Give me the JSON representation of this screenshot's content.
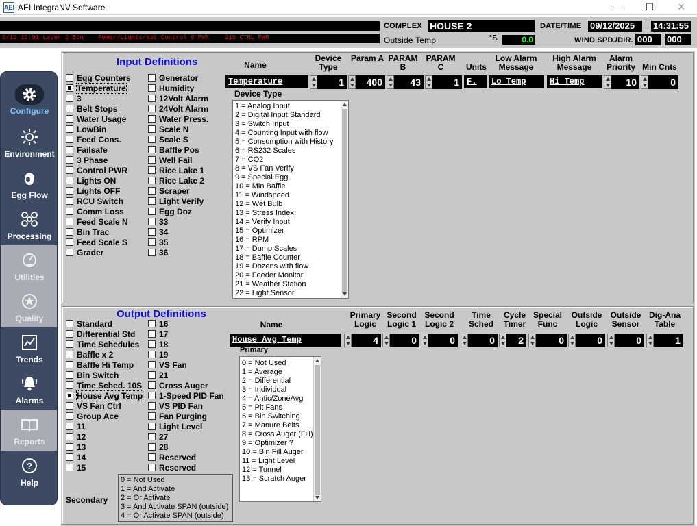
{
  "window": {
    "title": "AEI IntegraNV Software",
    "logo_text": "AEI",
    "min": "—",
    "max": "☐",
    "close": "✕"
  },
  "header": {
    "ticker": [
      "9/12 13:51 Layer 2 Btn",
      "Power/Lights/Nst Control 8 PWR",
      "215 CTRL PWR"
    ],
    "complex_label": "COMPLEX",
    "complex_value": "HOUSE 2",
    "outside_temp_label": "Outside Temp",
    "deg_f": "°F.",
    "outside_temp_value": "0.0",
    "datetime_label": "DATE/TIME",
    "date": "09/12/2025",
    "time": "14:31:55",
    "wind_label": "WIND SPD./DIR.",
    "wind_speed": "000",
    "wind_dir": "000"
  },
  "sidebar": [
    {
      "label": "Configure",
      "icon": "gear-icon",
      "state": "active"
    },
    {
      "label": "Environment",
      "icon": "sun-icon",
      "state": "normal"
    },
    {
      "label": "Egg Flow",
      "icon": "egg-icon",
      "state": "normal"
    },
    {
      "label": "Processing",
      "icon": "processing-icon",
      "state": "normal"
    },
    {
      "label": "Utilities",
      "icon": "gauge-icon",
      "state": "disabled"
    },
    {
      "label": "Quality",
      "icon": "star-icon",
      "state": "disabled"
    },
    {
      "label": "Trends",
      "icon": "chart-icon",
      "state": "normal"
    },
    {
      "label": "Alarms",
      "icon": "bell-icon",
      "state": "normal"
    },
    {
      "label": "Reports",
      "icon": "book-icon",
      "state": "disabled"
    },
    {
      "label": "Help",
      "icon": "help-icon",
      "state": "normal"
    }
  ],
  "input": {
    "title": "Input Definitions",
    "col1": [
      {
        "label": "Egg Counters",
        "checked": false
      },
      {
        "label": "Temperature",
        "checked": true
      },
      {
        "label": "3",
        "checked": false
      },
      {
        "label": "Belt Stops",
        "checked": false
      },
      {
        "label": "Water Usage",
        "checked": false
      },
      {
        "label": "LowBin",
        "checked": false
      },
      {
        "label": "Feed Cons.",
        "checked": false
      },
      {
        "label": "Failsafe",
        "checked": false
      },
      {
        "label": "3 Phase",
        "checked": false
      },
      {
        "label": "Control PWR",
        "checked": false
      },
      {
        "label": "Lights ON",
        "checked": false
      },
      {
        "label": "Lights OFF",
        "checked": false
      },
      {
        "label": "RCU Switch",
        "checked": false
      },
      {
        "label": "Comm Loss",
        "checked": false
      },
      {
        "label": "Feed Scale N",
        "checked": false
      },
      {
        "label": "Bin Trac",
        "checked": false
      },
      {
        "label": "Feed Scale S",
        "checked": false
      },
      {
        "label": "Grader",
        "checked": false
      }
    ],
    "col2": [
      {
        "label": "Generator",
        "checked": false
      },
      {
        "label": "Humidity",
        "checked": false
      },
      {
        "label": "12Volt Alarm",
        "checked": false
      },
      {
        "label": "24Volt Alarm",
        "checked": false
      },
      {
        "label": "Water Press.",
        "checked": false
      },
      {
        "label": "Scale N",
        "checked": false
      },
      {
        "label": "Scale S",
        "checked": false
      },
      {
        "label": "Baffle Pos",
        "checked": false
      },
      {
        "label": "Well Fail",
        "checked": false
      },
      {
        "label": "Rice Lake 1",
        "checked": false
      },
      {
        "label": "Rice Lake 2",
        "checked": false
      },
      {
        "label": "Scraper",
        "checked": false
      },
      {
        "label": "Light Verify",
        "checked": false
      },
      {
        "label": "Egg Doz",
        "checked": false
      },
      {
        "label": "33",
        "checked": false
      },
      {
        "label": "34",
        "checked": false
      },
      {
        "label": "35",
        "checked": false
      },
      {
        "label": "36",
        "checked": false
      }
    ],
    "headers": {
      "name": "Name",
      "device_type": "Device\nType",
      "param_a": "Param A",
      "param_b": "PARAM\nB",
      "param_c": "PARAM\nC",
      "units": "Units",
      "low_alarm": "Low Alarm\nMessage",
      "high_alarm": "High Alarm\nMessage",
      "alarm_priority": "Alarm\nPriority",
      "min_cnts": "Min Cnts"
    },
    "values": {
      "name": "Temperature",
      "device_type": "1",
      "param_a": "400",
      "param_b": "43",
      "param_c": "1",
      "units": "F.",
      "low_alarm": "Lo Temp",
      "high_alarm": "Hi Temp",
      "alarm_priority": "10",
      "min_cnts": "0"
    },
    "device_type_title": "Device Type",
    "device_types": [
      "1 = Analog Input",
      "2 = Digital Input Standard",
      "3 = Switch Input",
      "4 = Counting Input with flow",
      "5 = Consumption with History",
      "6 = RS232 Scales",
      "7 = CO2",
      "8 = VS Fan Verify",
      "9 = Special Egg",
      "10 = Min Baffle",
      "11 = Windspeed",
      "12 = Wet Bulb",
      "13 = Stress Index",
      "14 = Verify Input",
      "15 = Optimizer",
      "16 = RPM",
      "17 = Dump Scales",
      "18 = Baffle Counter",
      "19 = Dozens with flow",
      "20 = Feeder Monitor",
      "21 = Weather Station",
      "22 = Light Sensor"
    ]
  },
  "output": {
    "title": "Output Definitions",
    "col1": [
      {
        "label": "Standard",
        "checked": false
      },
      {
        "label": "Differential Std",
        "checked": false
      },
      {
        "label": "Time Schedules",
        "checked": false
      },
      {
        "label": "Baffle x 2",
        "checked": false
      },
      {
        "label": "Baffle Hi Temp",
        "checked": false
      },
      {
        "label": "Bin Switch",
        "checked": false
      },
      {
        "label": "Time Sched. 10S",
        "checked": false
      },
      {
        "label": "House Avg Temp",
        "checked": true
      },
      {
        "label": "VS Fan Ctrl",
        "checked": false
      },
      {
        "label": "Group Ace",
        "checked": false
      },
      {
        "label": "11",
        "checked": false
      },
      {
        "label": "12",
        "checked": false
      },
      {
        "label": "13",
        "checked": false
      },
      {
        "label": "14",
        "checked": false
      },
      {
        "label": "15",
        "checked": false
      }
    ],
    "col2": [
      {
        "label": "16",
        "checked": false
      },
      {
        "label": "17",
        "checked": false
      },
      {
        "label": "18",
        "checked": false
      },
      {
        "label": "19",
        "checked": false
      },
      {
        "label": "VS Fan",
        "checked": false
      },
      {
        "label": "21",
        "checked": false
      },
      {
        "label": "Cross Auger",
        "checked": false
      },
      {
        "label": "1-Speed PID Fan",
        "checked": false
      },
      {
        "label": "VS PID Fan",
        "checked": false
      },
      {
        "label": "Fan Purging",
        "checked": false
      },
      {
        "label": "Light Level",
        "checked": false
      },
      {
        "label": "27",
        "checked": false
      },
      {
        "label": "28",
        "checked": false
      },
      {
        "label": "Reserved",
        "checked": false
      },
      {
        "label": "Reserved",
        "checked": false
      }
    ],
    "headers": {
      "name": "Name",
      "primary_logic": "Primary\nLogic",
      "second_logic_1": "Second\nLogic 1",
      "second_logic_2": "Second\nLogic 2",
      "time_sched": "Time\nSched",
      "cycle_timer": "Cycle\nTimer",
      "special_func": "Special\nFunc",
      "outside_logic": "Outside\nLogic",
      "outside_sensor": "Outside\nSensor",
      "dig_ana_table": "Dig-Ana\nTable"
    },
    "values": {
      "name": "House Avg Temp",
      "primary_logic": "4",
      "second_logic_1": "0",
      "second_logic_2": "0",
      "time_sched": "0",
      "cycle_timer": "2",
      "special_func": "0",
      "outside_logic": "0",
      "outside_sensor": "0",
      "dig_ana_table": "1"
    },
    "primary_title": "Primary",
    "primary_list": [
      "0 = Not Used",
      "1 = Average",
      "2 = Differential",
      "3 = Individual",
      "4 = Antic/ZoneAvg",
      "5 = Pit Fans",
      "6 = Bin Switching",
      "7 = Manure Belts",
      "8 = Cross Auger (Fill)",
      "9 = Optimizer ?",
      "10 = Bin Fill Auger",
      "11 = Light Level",
      "12 = Tunnel",
      "13 = Scratch Auger"
    ],
    "secondary_title": "Secondary",
    "secondary_list": [
      "0 = Not Used",
      "1 = And Activate",
      "2 = Or Activate",
      "3 = And Activate SPAN (outside)",
      "4 = Or Activate SPAN (outside)"
    ]
  }
}
